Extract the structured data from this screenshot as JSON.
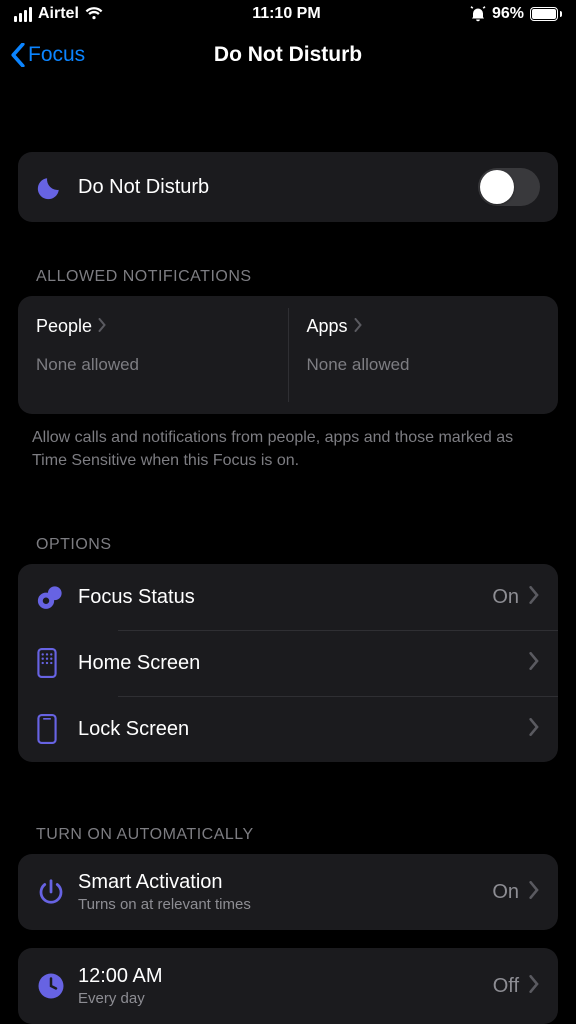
{
  "status": {
    "carrier": "Airtel",
    "time": "11:10 PM",
    "battery_pct": "96%"
  },
  "nav": {
    "back_label": "Focus",
    "title": "Do Not Disturb"
  },
  "dnd_toggle": {
    "label": "Do Not Disturb",
    "on": false
  },
  "allowed": {
    "header": "ALLOWED NOTIFICATIONS",
    "people": {
      "title": "People",
      "sub": "None allowed"
    },
    "apps": {
      "title": "Apps",
      "sub": "None allowed"
    },
    "desc": "Allow calls and notifications from people, apps and those marked as Time Sensitive when this Focus is on."
  },
  "options": {
    "header": "OPTIONS",
    "focus_status": {
      "title": "Focus Status",
      "value": "On"
    },
    "home_screen": {
      "title": "Home Screen"
    },
    "lock_screen": {
      "title": "Lock Screen"
    }
  },
  "auto": {
    "header": "TURN ON AUTOMATICALLY",
    "smart": {
      "title": "Smart Activation",
      "sub": "Turns on at relevant times",
      "value": "On"
    },
    "schedule": {
      "title": "12:00 AM",
      "sub": "Every day",
      "value": "Off"
    }
  }
}
